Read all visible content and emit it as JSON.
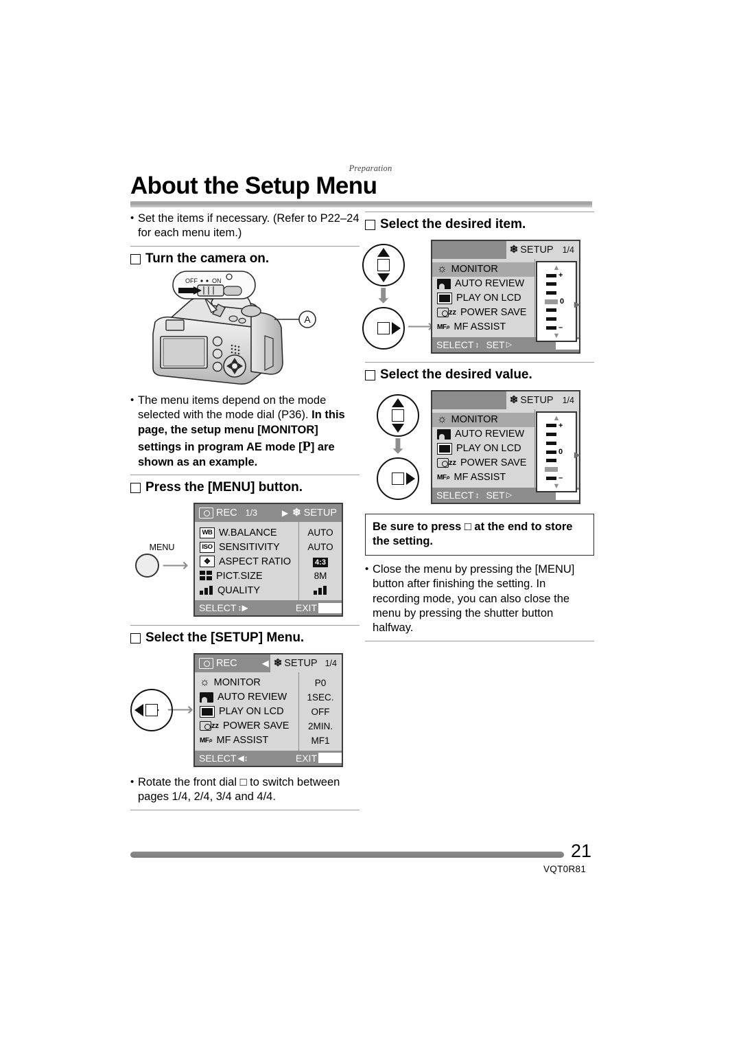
{
  "document": {
    "running_head": "Preparation",
    "title": "About the Setup Menu",
    "page_number": "21",
    "doc_code": "VQT0R81"
  },
  "left_column": {
    "intro_bullet": "Set the items if necessary. (Refer to P22–24 for each menu item.)",
    "step1_label": "Turn the camera on.",
    "camera_switch": {
      "off_label": "OFF",
      "on_label": "ON",
      "callout": "A"
    },
    "mode_note_plain": "The menu items depend on the mode selected with the mode dial (P36).",
    "mode_note_bold_1": "In this page, the setup menu [MONITOR] settings in program AE mode [",
    "mode_note_p": "P",
    "mode_note_bold_2": "] are shown as an example.",
    "step2_label": "Press the [MENU] button.",
    "menu_button_label": "MENU",
    "rec_menu": {
      "tab_left": "REC",
      "page_indicator": "1/3",
      "tab_right": "SETUP",
      "rows": [
        {
          "icon": "wb-icon",
          "icon_text": "WB",
          "label": "W.BALANCE",
          "value": "AUTO"
        },
        {
          "icon": "iso-icon",
          "icon_text": "ISO",
          "label": "SENSITIVITY",
          "value": "AUTO"
        },
        {
          "icon": "aspect-ratio-icon",
          "icon_text": "",
          "label": "ASPECT RATIO",
          "value": "4:3"
        },
        {
          "icon": "picture-size-icon",
          "icon_text": "",
          "label": "PICT.SIZE",
          "value": "8M"
        },
        {
          "icon": "quality-icon",
          "icon_text": "",
          "label": "QUALITY",
          "value": ""
        }
      ],
      "footer_select": "SELECT",
      "footer_exit": "EXIT"
    },
    "step3_label": "Select the [SETUP] Menu.",
    "setup_menu": {
      "tab_left": "REC",
      "tab_right": "SETUP",
      "page_indicator": "1/4",
      "rows": [
        {
          "icon": "sun-icon",
          "label": "MONITOR",
          "value": "P0"
        },
        {
          "icon": "auto-review-icon",
          "label": "AUTO REVIEW",
          "value": "1SEC."
        },
        {
          "icon": "play-on-lcd-icon",
          "label": "PLAY ON LCD",
          "value": "OFF"
        },
        {
          "icon": "power-save-icon",
          "label": "POWER SAVE",
          "value": "2MIN."
        },
        {
          "icon": "mf-assist-icon",
          "label": "MF ASSIST",
          "value": "MF1"
        }
      ],
      "footer_select": "SELECT",
      "footer_exit": "EXIT"
    },
    "front_dial_bullet": "Rotate the front dial □ to switch between pages 1/4, 2/4, 3/4 and 4/4."
  },
  "right_column": {
    "step4_label": "Select the desired item.",
    "item_menu": {
      "tab_right": "SETUP",
      "page_indicator": "1/4",
      "rows": [
        {
          "icon": "sun-icon",
          "label": "MONITOR",
          "selected": true
        },
        {
          "icon": "auto-review-icon",
          "label": "AUTO REVIEW",
          "selected": false
        },
        {
          "icon": "play-on-lcd-icon",
          "label": "PLAY ON LCD",
          "selected": false
        },
        {
          "icon": "power-save-icon",
          "label": "POWER SAVE",
          "selected": false
        },
        {
          "icon": "mf-assist-icon",
          "label": "MF ASSIST",
          "selected": false
        }
      ],
      "footer_select": "SELECT",
      "footer_set": "SET",
      "slider": {
        "plus_label": "+",
        "zero_label": "0",
        "minus_label": "–",
        "highlight_index": 3,
        "ticks": 7
      }
    },
    "step5_label": "Select the desired value.",
    "value_menu": {
      "tab_right": "SETUP",
      "page_indicator": "1/4",
      "rows": [
        {
          "icon": "sun-icon",
          "label": "MONITOR",
          "selected": true
        },
        {
          "icon": "auto-review-icon",
          "label": "AUTO REVIEW",
          "selected": false
        },
        {
          "icon": "play-on-lcd-icon",
          "label": "PLAY ON LCD",
          "selected": false
        },
        {
          "icon": "power-save-icon",
          "label": "POWER SAVE",
          "selected": false
        },
        {
          "icon": "mf-assist-icon",
          "label": "MF ASSIST",
          "selected": false
        }
      ],
      "footer_select": "SELECT",
      "footer_set": "SET",
      "slider": {
        "plus_label": "+",
        "zero_label": "0",
        "minus_label": "–",
        "highlight_index": 5,
        "ticks": 7
      }
    },
    "note_box": "Be sure to press □  at the end to store the setting.",
    "close_bullet": "Close the menu by pressing the [MENU] button after finishing the setting. In recording mode, you can also close the menu by pressing the shutter button halfway."
  }
}
